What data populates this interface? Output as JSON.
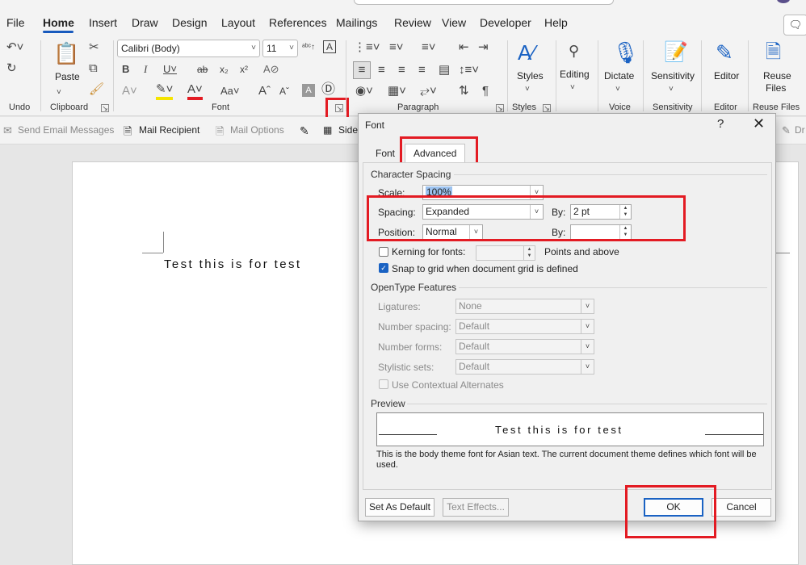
{
  "menu": {
    "tabs": [
      "File",
      "Home",
      "Insert",
      "Draw",
      "Design",
      "Layout",
      "References",
      "Mailings",
      "Review",
      "View",
      "Developer",
      "Help"
    ],
    "active": "Home"
  },
  "ribbon": {
    "groups": {
      "undo": "Undo",
      "clipboard": "Clipboard",
      "font": "Font",
      "paragraph": "Paragraph",
      "styles": "Styles",
      "voice": "Voice",
      "sensitivity": "Sensitivity",
      "editor": "Editor",
      "reuse_files": "Reuse Files"
    },
    "paste_label": "Paste",
    "font_name": "Calibri (Body)",
    "font_size": "11",
    "styles_label": "Styles",
    "editing_label": "Editing",
    "dictate_label": "Dictate",
    "sensitivity_label": "Sensitivity",
    "editor_label": "Editor",
    "reuse_label_1": "Reuse",
    "reuse_label_2": "Files"
  },
  "mailbar": {
    "send_email": "Send Email Messages",
    "mail_recipient": "Mail Recipient",
    "mail_options": "Mail Options",
    "side": "Side",
    "draw_cut": "Dr"
  },
  "document": {
    "text": "Test this is for test"
  },
  "dialog": {
    "title": "Font",
    "help": "?",
    "tabs": [
      "Font",
      "Advanced"
    ],
    "selected_tab": "Advanced",
    "character_spacing": {
      "heading": "Character Spacing",
      "scale_label": "Scale:",
      "scale_value": "100%",
      "spacing_label": "Spacing:",
      "spacing_value": "Expanded",
      "spacing_by_label": "By:",
      "spacing_by_value": "2 pt",
      "position_label": "Position:",
      "position_value": "Normal",
      "position_by_label": "By:",
      "position_by_value": "",
      "kerning_label": "Kerning for fonts:",
      "kerning_checked": false,
      "points_label": "Points and above",
      "snap_label": "Snap to grid when document grid is defined",
      "snap_checked": true
    },
    "opentype": {
      "heading": "OpenType Features",
      "ligatures_label": "Ligatures:",
      "ligatures_value": "None",
      "number_spacing_label": "Number spacing:",
      "number_spacing_value": "Default",
      "number_forms_label": "Number forms:",
      "number_forms_value": "Default",
      "stylistic_sets_label": "Stylistic sets:",
      "stylistic_sets_value": "Default",
      "contextual_alternates_label": "Use Contextual Alternates"
    },
    "preview": {
      "heading": "Preview",
      "text": "Test this is for test",
      "note": "This is the body theme font for Asian text. The current document theme defines which font will be used."
    },
    "buttons": {
      "set_default": "Set As Default",
      "text_effects": "Text Effects...",
      "ok": "OK",
      "cancel": "Cancel"
    }
  },
  "colors": {
    "accent": "#185abd",
    "highlight_annotation": "#e31b23",
    "checkbox_on": "#1a62c3"
  }
}
